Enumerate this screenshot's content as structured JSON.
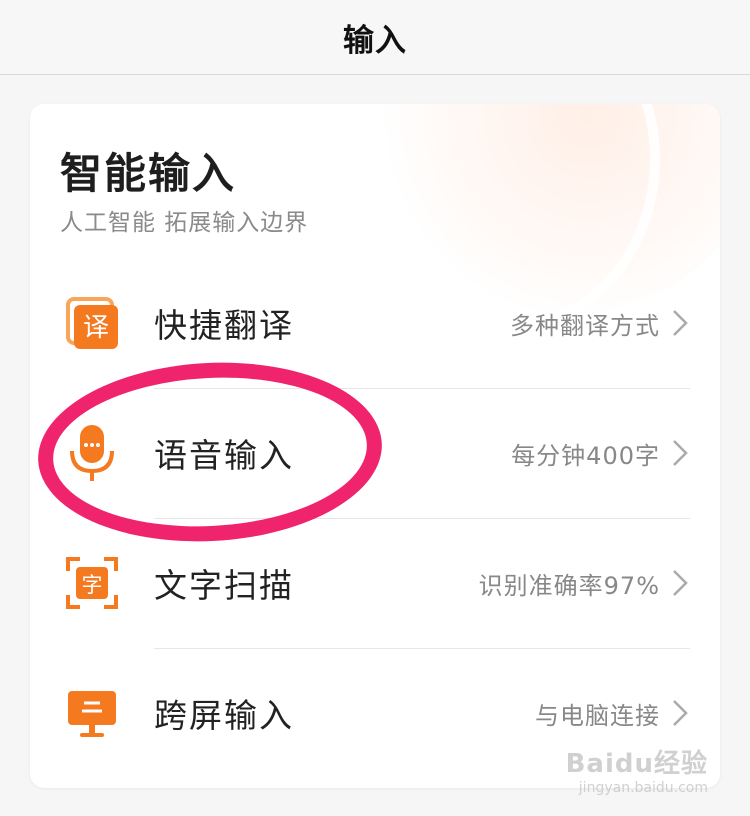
{
  "header": {
    "title": "输入"
  },
  "card": {
    "title": "智能输入",
    "subtitle": "人工智能 拓展输入边界",
    "items": [
      {
        "label": "快捷翻译",
        "desc": "多种翻译方式",
        "icon": "translate-icon",
        "glyph": "译"
      },
      {
        "label": "语音输入",
        "desc": "每分钟400字",
        "icon": "microphone-icon"
      },
      {
        "label": "文字扫描",
        "desc": "识别准确率97%",
        "icon": "text-scan-icon",
        "glyph": "字"
      },
      {
        "label": "跨屏输入",
        "desc": "与电脑连接",
        "icon": "monitor-icon"
      }
    ]
  },
  "watermark": {
    "main": "Baidu经验",
    "sub": "jingyan.baidu.com"
  },
  "colors": {
    "accent_orange": "#f57a1f",
    "highlight": "#f0236d"
  }
}
